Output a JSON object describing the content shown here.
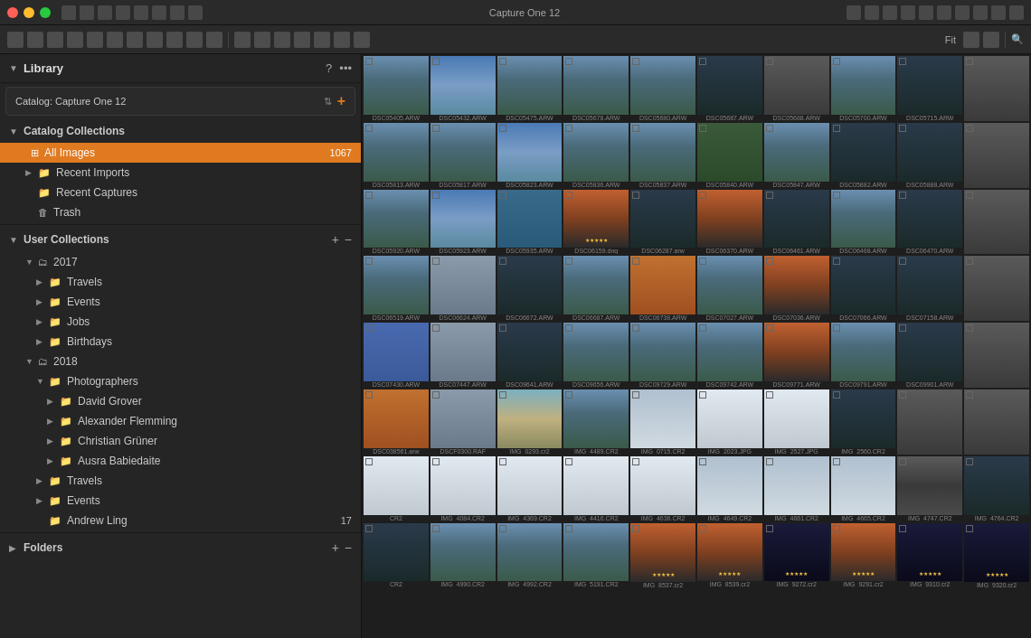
{
  "titlebar": {
    "title": "Capture One 12",
    "close": "●",
    "minimize": "●",
    "maximize": "●"
  },
  "sidebar": {
    "library_title": "Library",
    "catalog_label": "Catalog: Capture One 12",
    "catalog_collections_title": "Catalog Collections",
    "all_images_label": "All Images",
    "all_images_count": "1067",
    "recent_imports_label": "Recent Imports",
    "recent_captures_label": "Recent Captures",
    "trash_label": "Trash",
    "user_collections_title": "User Collections",
    "year_2017_label": "2017",
    "travels_2017_label": "Travels",
    "events_2017_label": "Events",
    "jobs_2017_label": "Jobs",
    "birthdays_2017_label": "Birthdays",
    "year_2018_label": "2018",
    "photographers_label": "Photographers",
    "david_grover_label": "David Grover",
    "alexander_flemming_label": "Alexander Flemming",
    "christian_gruner_label": "Christian Grüner",
    "ausra_babiedaite_label": "Ausra Babiedaite",
    "travels_2018_label": "Travels",
    "events_2018_label": "Events",
    "andrew_ling_label": "Andrew Ling",
    "andrew_ling_count": "17",
    "folders_label": "Folders"
  },
  "grid": {
    "images": [
      {
        "label": "DSC05405.ARW",
        "style": "img-mountain"
      },
      {
        "label": "DSC05432.ARW",
        "style": "img-sky"
      },
      {
        "label": "DSC05475.ARW",
        "style": "img-mountain"
      },
      {
        "label": "DSC05678.ARW",
        "style": "img-mountain"
      },
      {
        "label": "DSC05680.ARW",
        "style": "img-mountain"
      },
      {
        "label": "DSC05687.ARW",
        "style": "img-dark"
      },
      {
        "label": "DSC05688.ARW",
        "style": "img-gray"
      },
      {
        "label": "DSC05700.ARW",
        "style": "img-mountain"
      },
      {
        "label": "DSC05715.ARW",
        "style": "img-dark"
      },
      {
        "label": "",
        "style": "img-gray"
      },
      {
        "label": "DSC05813.ARW",
        "style": "img-mountain"
      },
      {
        "label": "DSC05817.ARW",
        "style": "img-mountain"
      },
      {
        "label": "DSC05823.ARW",
        "style": "img-sky"
      },
      {
        "label": "DSC05836.ARW",
        "style": "img-mountain"
      },
      {
        "label": "DSC05837.ARW",
        "style": "img-mountain"
      },
      {
        "label": "DSC05840.ARW",
        "style": "img-forest"
      },
      {
        "label": "DSC05847.ARW",
        "style": "img-mountain"
      },
      {
        "label": "DSC05882.ARW",
        "style": "img-dark"
      },
      {
        "label": "DSC05888.ARW",
        "style": "img-dark"
      },
      {
        "label": "",
        "style": "img-gray"
      },
      {
        "label": "DSC05920.ARW",
        "style": "img-mountain"
      },
      {
        "label": "DSC05923.ARW",
        "style": "img-sky"
      },
      {
        "label": "DSC05935.ARW",
        "style": "img-water"
      },
      {
        "label": "DSC06159.dng",
        "style": "img-sunset",
        "stars": "★★★★★"
      },
      {
        "label": "DSC06287.arw",
        "style": "img-dark"
      },
      {
        "label": "DSC06370.ARW",
        "style": "img-sunset"
      },
      {
        "label": "DSC06461.ARW",
        "style": "img-dark"
      },
      {
        "label": "DSC06468.ARW",
        "style": "img-mountain"
      },
      {
        "label": "DSC06470.ARW",
        "style": "img-dark"
      },
      {
        "label": "",
        "style": "img-gray"
      },
      {
        "label": "DSC06519.ARW",
        "style": "img-mountain"
      },
      {
        "label": "DSC06624.ARW",
        "style": "img-light"
      },
      {
        "label": "DSC06672.ARW",
        "style": "img-dark"
      },
      {
        "label": "DSC06687.ARW",
        "style": "img-mountain"
      },
      {
        "label": "DSC06738.ARW",
        "style": "img-orange"
      },
      {
        "label": "DSC07027.ARW",
        "style": "img-mountain"
      },
      {
        "label": "DSC07036.ARW",
        "style": "img-sunset"
      },
      {
        "label": "DSC07066.ARW",
        "style": "img-dark"
      },
      {
        "label": "DSC07158.ARW",
        "style": "img-dark"
      },
      {
        "label": "",
        "style": "img-gray"
      },
      {
        "label": "DSC07430.ARW",
        "style": "img-blue"
      },
      {
        "label": "DSC07447.ARW",
        "style": "img-light"
      },
      {
        "label": "DSC09641.ARW",
        "style": "img-dark"
      },
      {
        "label": "DSC09656.ARW",
        "style": "img-mountain"
      },
      {
        "label": "DSC09729.ARW",
        "style": "img-mountain"
      },
      {
        "label": "DSC09742.ARW",
        "style": "img-mountain"
      },
      {
        "label": "DSC09771.ARW",
        "style": "img-sunset"
      },
      {
        "label": "DSC09791.ARW",
        "style": "img-mountain"
      },
      {
        "label": "DSC09901.ARW",
        "style": "img-dark"
      },
      {
        "label": "",
        "style": "img-gray"
      },
      {
        "label": "DSC038561.arw",
        "style": "img-orange"
      },
      {
        "label": "DSCF0300.RAF",
        "style": "img-light"
      },
      {
        "label": "IMG_0293.cr2",
        "style": "img-beach"
      },
      {
        "label": "IMG_4489.CR2",
        "style": "img-mountain"
      },
      {
        "label": "IMG_0715.CR2",
        "style": "img-snow"
      },
      {
        "label": "IMG_2023.JPG",
        "style": "img-sport"
      },
      {
        "label": "IMG_2527.JPG",
        "style": "img-sport"
      },
      {
        "label": "IMG_2560.CR2",
        "style": "img-dark"
      },
      {
        "label": "",
        "style": "img-gray"
      },
      {
        "label": "",
        "style": "img-gray"
      },
      {
        "label": "CR2",
        "style": "img-sport"
      },
      {
        "label": "IMG_4084.CR2",
        "style": "img-sport"
      },
      {
        "label": "IMG_4369.CR2",
        "style": "img-sport"
      },
      {
        "label": "IMG_4416.CR2",
        "style": "img-sport"
      },
      {
        "label": "IMG_4636.CR2",
        "style": "img-sport"
      },
      {
        "label": "IMG_4649.CR2",
        "style": "img-snow"
      },
      {
        "label": "IMG_4661.CR2",
        "style": "img-snow"
      },
      {
        "label": "IMG_4665.CR2",
        "style": "img-snow"
      },
      {
        "label": "IMG_4747.CR2",
        "style": "img-road"
      },
      {
        "label": "IMG_4764.CR2",
        "style": "img-dark"
      },
      {
        "label": "CR2",
        "style": "img-dark"
      },
      {
        "label": "IMG_4990.CR2",
        "style": "img-mountain"
      },
      {
        "label": "IMG_4992.CR2",
        "style": "img-mountain"
      },
      {
        "label": "IMG_5191.CR2",
        "style": "img-mountain"
      },
      {
        "label": "IMG_8537.cr2",
        "style": "img-sunset",
        "stars": "★★★★★"
      },
      {
        "label": "IMG_8539.cr2",
        "style": "img-sunset",
        "stars": "★★★★★"
      },
      {
        "label": "IMG_9272.cr2",
        "style": "img-night",
        "stars": "★★★★★"
      },
      {
        "label": "IMG_9291.cr2",
        "style": "img-sunset",
        "stars": "★★★★★"
      },
      {
        "label": "IMG_9310.cr2",
        "style": "img-night",
        "stars": "★★★★★"
      },
      {
        "label": "IMG_9320.cr2",
        "style": "img-night",
        "stars": "★★★★★"
      }
    ]
  }
}
